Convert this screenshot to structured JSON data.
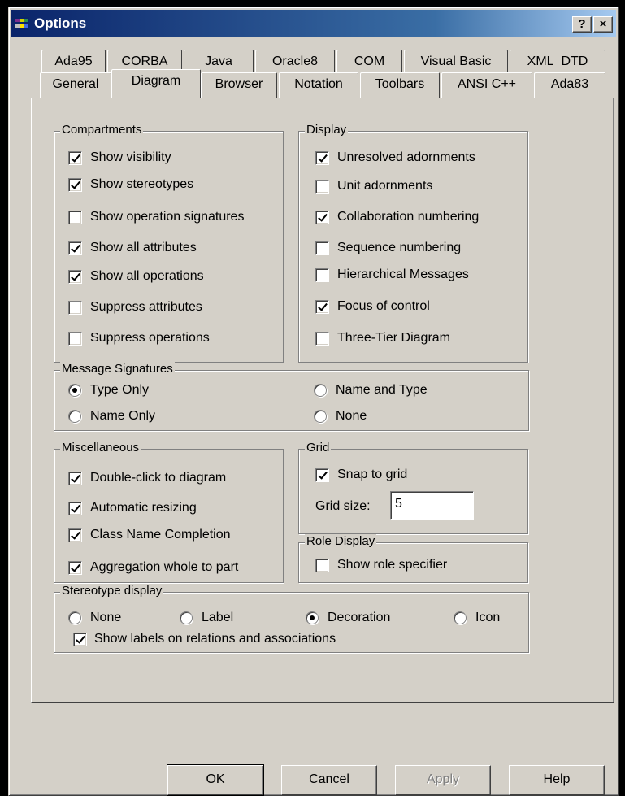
{
  "window": {
    "title": "Options",
    "help_button": "?",
    "close_button": "×"
  },
  "tabs": {
    "row1": [
      "Ada95",
      "CORBA",
      "Java",
      "Oracle8",
      "COM",
      "Visual Basic",
      "XML_DTD"
    ],
    "row2": [
      "General",
      "Diagram",
      "Browser",
      "Notation",
      "Toolbars",
      "ANSI C++",
      "Ada83"
    ],
    "active": "Diagram"
  },
  "compartments": {
    "title": "Compartments",
    "items": [
      {
        "label": "Show visibility",
        "checked": true
      },
      {
        "label": "Show stereotypes",
        "checked": true
      },
      {
        "label": "Show operation signatures",
        "checked": false
      },
      {
        "label": "Show all attributes",
        "checked": true
      },
      {
        "label": "Show all operations",
        "checked": true
      },
      {
        "label": "Suppress attributes",
        "checked": false
      },
      {
        "label": "Suppress operations",
        "checked": false
      }
    ]
  },
  "display": {
    "title": "Display",
    "items": [
      {
        "label": "Unresolved adornments",
        "checked": true
      },
      {
        "label": "Unit adornments",
        "checked": false
      },
      {
        "label": "Collaboration numbering",
        "checked": true
      },
      {
        "label": "Sequence numbering",
        "checked": false
      },
      {
        "label": "Hierarchical Messages",
        "checked": false
      },
      {
        "label": "Focus of control",
        "checked": true
      },
      {
        "label": "Three-Tier Diagram",
        "checked": false
      }
    ]
  },
  "message_signatures": {
    "title": "Message Signatures",
    "options": [
      {
        "label": "Type Only",
        "selected": true
      },
      {
        "label": "Name and Type",
        "selected": false
      },
      {
        "label": "Name Only",
        "selected": false
      },
      {
        "label": "None",
        "selected": false
      }
    ]
  },
  "miscellaneous": {
    "title": "Miscellaneous",
    "items": [
      {
        "label": "Double-click to diagram",
        "checked": true
      },
      {
        "label": "Automatic resizing",
        "checked": true
      },
      {
        "label": "Class Name Completion",
        "checked": true
      },
      {
        "label": "Aggregation whole to part",
        "checked": true
      }
    ]
  },
  "grid": {
    "title": "Grid",
    "snap_label": "Snap to grid",
    "snap_checked": true,
    "size_label": "Grid size:",
    "size_value": "5"
  },
  "role_display": {
    "title": "Role Display",
    "label": "Show role specifier",
    "checked": false
  },
  "stereotype_display": {
    "title": "Stereotype display",
    "options": [
      {
        "label": "None",
        "selected": false
      },
      {
        "label": "Label",
        "selected": false
      },
      {
        "label": "Decoration",
        "selected": true
      },
      {
        "label": "Icon",
        "selected": false
      }
    ],
    "relations_label": "Show labels on relations and associations",
    "relations_checked": true
  },
  "buttons": {
    "ok": "OK",
    "cancel": "Cancel",
    "apply": "Apply",
    "help": "Help"
  }
}
